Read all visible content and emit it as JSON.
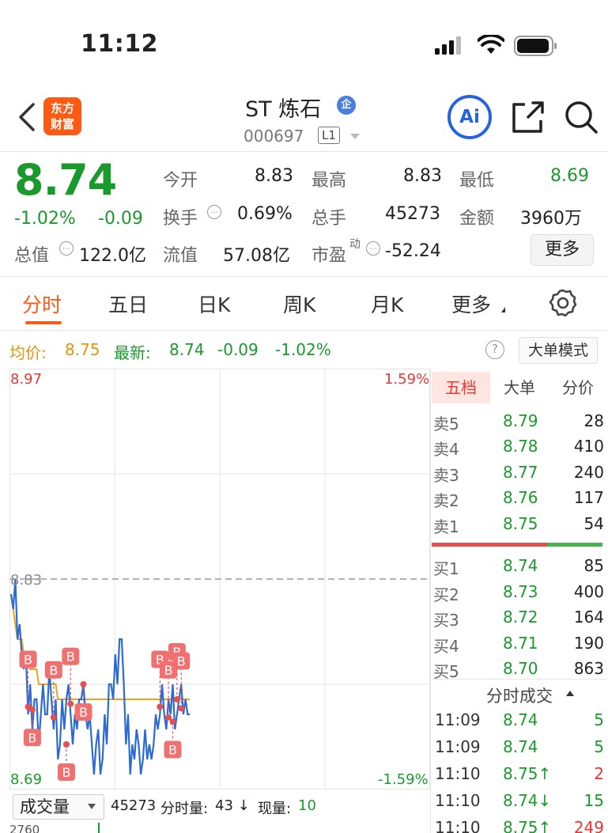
{
  "status_bar": {
    "time": "11:12"
  },
  "header": {
    "logo_line1": "东方",
    "logo_line2": "财富",
    "title": "ST 炼石",
    "badge": "企",
    "code": "000697",
    "level": "L1",
    "ai_label": "Ai"
  },
  "quote": {
    "price": "8.74",
    "change_pct": "-1.02%",
    "change": "-0.09",
    "open_label": "今开",
    "open": "8.83",
    "high_label": "最高",
    "high": "8.83",
    "low_label": "最低",
    "low": "8.69",
    "turnover_label": "换手",
    "turnover": "0.69%",
    "volume_label": "总手",
    "volume": "45273",
    "amount_label": "金额",
    "amount": "3960万",
    "mcap_label": "总值",
    "mcap": "122.0亿",
    "float_label": "流值",
    "float": "57.08亿",
    "pe_label": "市盈",
    "pe_sup": "动",
    "pe": "-52.24",
    "more": "更多"
  },
  "tabs": [
    "分时",
    "五日",
    "日K",
    "周K",
    "月K",
    "更多"
  ],
  "indicator": {
    "avg_label": "均价:",
    "avg": "8.75",
    "latest_label": "最新:",
    "latest": "8.74",
    "change": "-0.09",
    "change_pct": "-1.02%",
    "help": "?",
    "mode": "大单模式"
  },
  "chart_data": {
    "type": "line",
    "y_max_label": "8.97",
    "y_min_label": "8.69",
    "prev_close_label": "8.83",
    "pct_max_label": "1.59%",
    "pct_min_label": "-1.59%",
    "ylim": [
      8.69,
      8.97
    ],
    "prev_close": 8.83,
    "series": [
      {
        "values": [
          8.82,
          8.81,
          8.83,
          8.79,
          8.8,
          8.78,
          8.77,
          8.78,
          8.74,
          8.76,
          8.73,
          8.75,
          8.75,
          8.72,
          8.74,
          8.76,
          8.74,
          8.74,
          8.77,
          8.75,
          8.73,
          8.75,
          8.71,
          8.72,
          8.75,
          8.73,
          8.75,
          8.76,
          8.74,
          8.72,
          8.74,
          8.73,
          8.75,
          8.75,
          8.76,
          8.74,
          8.73,
          8.74,
          8.72,
          8.7,
          8.72,
          8.73,
          8.7,
          8.71,
          8.74,
          8.72,
          8.76,
          8.76,
          8.75,
          8.78,
          8.76,
          8.79,
          8.79,
          8.76,
          8.72,
          8.74,
          8.7,
          8.72,
          8.71,
          8.73,
          8.72,
          8.7,
          8.71,
          8.73,
          8.71,
          8.72,
          8.71,
          8.72,
          8.74,
          8.73,
          8.74,
          8.76,
          8.74,
          8.73,
          8.75,
          8.74,
          8.76,
          8.73,
          8.74,
          8.75,
          8.76,
          8.74,
          8.75,
          8.74,
          8.74
        ]
      },
      {
        "values": [
          8.82,
          8.81,
          8.8,
          8.79,
          8.79,
          8.79,
          8.78,
          8.78,
          8.78,
          8.77,
          8.77,
          8.77,
          8.77,
          8.76,
          8.76,
          8.76,
          8.76,
          8.76,
          8.76,
          8.76,
          8.76,
          8.76,
          8.75,
          8.75,
          8.75,
          8.75,
          8.75,
          8.75,
          8.75,
          8.75,
          8.75,
          8.75,
          8.75,
          8.75,
          8.75,
          8.75,
          8.75,
          8.75,
          8.75,
          8.75,
          8.75,
          8.75,
          8.75,
          8.75,
          8.75,
          8.75,
          8.75,
          8.75,
          8.75,
          8.75,
          8.75,
          8.75,
          8.75,
          8.75,
          8.75,
          8.75,
          8.75,
          8.75,
          8.75,
          8.75,
          8.75,
          8.75,
          8.75,
          8.75,
          8.75,
          8.75,
          8.75,
          8.75,
          8.75,
          8.75,
          8.75,
          8.75,
          8.75,
          8.75,
          8.75,
          8.75,
          8.75,
          8.75,
          8.75,
          8.75,
          8.75,
          8.75,
          8.75,
          8.75,
          8.75
        ]
      }
    ],
    "markers": [
      {
        "label": "B",
        "i": 8,
        "y": 8.745,
        "side": "up"
      },
      {
        "label": "B",
        "i": 10,
        "y": 8.743,
        "side": "down"
      },
      {
        "label": "B",
        "i": 20,
        "y": 8.738,
        "side": "up"
      },
      {
        "label": "B",
        "i": 28,
        "y": 8.747,
        "side": "up"
      },
      {
        "label": "B",
        "i": 26,
        "y": 8.72,
        "side": "down"
      },
      {
        "label": "B",
        "i": 34,
        "y": 8.76,
        "side": "down"
      },
      {
        "label": "B",
        "i": 70,
        "y": 8.745,
        "side": "up"
      },
      {
        "label": "B",
        "i": 74,
        "y": 8.738,
        "side": "up"
      },
      {
        "label": "B",
        "i": 76,
        "y": 8.735,
        "side": "down"
      },
      {
        "label": "B",
        "i": 78,
        "y": 8.75,
        "side": "up"
      },
      {
        "label": "B",
        "i": 80,
        "y": 8.744,
        "side": "up"
      }
    ]
  },
  "order_book": {
    "tabs": [
      "五档",
      "大单",
      "分价"
    ],
    "asks": [
      {
        "name": "卖5",
        "price": "8.79",
        "vol": "28"
      },
      {
        "name": "卖4",
        "price": "8.78",
        "vol": "410"
      },
      {
        "name": "卖3",
        "price": "8.77",
        "vol": "240"
      },
      {
        "name": "卖2",
        "price": "8.76",
        "vol": "117"
      },
      {
        "name": "卖1",
        "price": "8.75",
        "vol": "54"
      }
    ],
    "bids": [
      {
        "name": "买1",
        "price": "8.74",
        "vol": "85"
      },
      {
        "name": "买2",
        "price": "8.73",
        "vol": "400"
      },
      {
        "name": "买3",
        "price": "8.72",
        "vol": "164"
      },
      {
        "name": "买4",
        "price": "8.71",
        "vol": "190"
      },
      {
        "name": "买5",
        "price": "8.70",
        "vol": "863"
      }
    ],
    "trades_title": "分时成交",
    "trades": [
      {
        "time": "11:09",
        "price": "8.74",
        "vol": "5",
        "vol_color": "#1a9a2c"
      },
      {
        "time": "11:09",
        "price": "8.74",
        "vol": "5",
        "vol_color": "#1a9a2c"
      },
      {
        "time": "11:10",
        "price": "8.75↑",
        "vol": "2",
        "vol_color": "#e53935"
      },
      {
        "time": "11:10",
        "price": "8.74↓",
        "vol": "15",
        "vol_color": "#1a9a2c"
      },
      {
        "time": "11:10",
        "price": "8.75↑",
        "vol": "249",
        "vol_color": "#e53935"
      }
    ]
  },
  "volume_bar": {
    "selector": "成交量",
    "total": "45273",
    "minute_label": "分时量:",
    "minute": "43 ↓",
    "current_label": "现量:",
    "current": "10",
    "axis": "2760"
  }
}
